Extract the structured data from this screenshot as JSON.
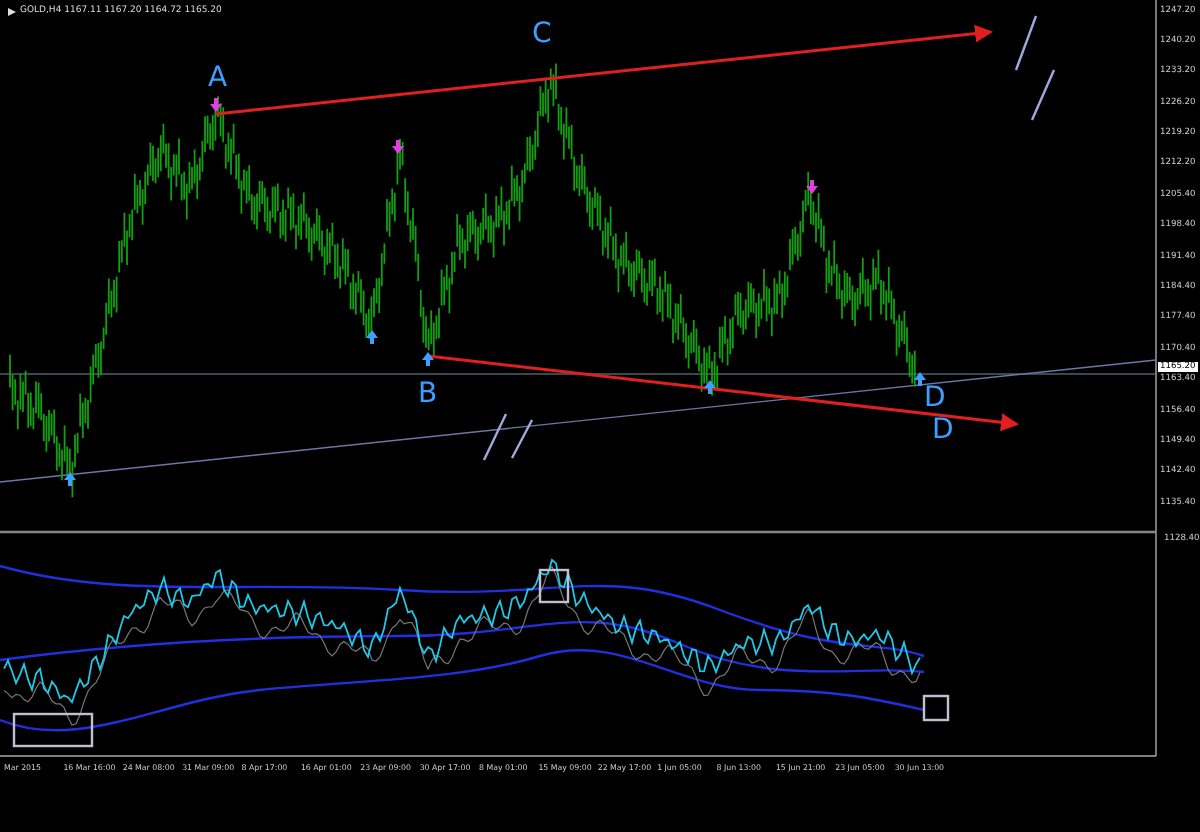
{
  "chart": {
    "symbol_info": "GOLD,H4  1167.11 1167.20 1164.72 1165.20",
    "wave_labels": [
      {
        "label": "A"
      },
      {
        "label": "B"
      },
      {
        "label": "C"
      },
      {
        "label": "D"
      },
      {
        "label": "D"
      }
    ],
    "current_price": "1165.20",
    "price_axis": [
      "1247.20",
      "1240.20",
      "1233.20",
      "1226.20",
      "1219.20",
      "1212.20",
      "1205.40",
      "1198.40",
      "1191.40",
      "1184.40",
      "1177.40",
      "1170.40",
      "1163.40",
      "1156.40",
      "1149.40",
      "1142.40",
      "1135.40"
    ],
    "indicator_axis": [
      "1128.40"
    ]
  },
  "time_axis": [
    "Mar 2015",
    "16 Mar 16:00",
    "24 Mar 08:00",
    "31 Mar 09:00",
    "8 Apr 17:00",
    "16 Apr 01:00",
    "23 Apr 09:00",
    "30 Apr 17:00",
    "8 May 01:00",
    "15 May 09:00",
    "22 May 17:00",
    "1 Jun 05:00",
    "8 Jun 13:00",
    "15 Jun 21:00",
    "23 Jun 05:00",
    "30 Jun 13:00"
  ]
}
